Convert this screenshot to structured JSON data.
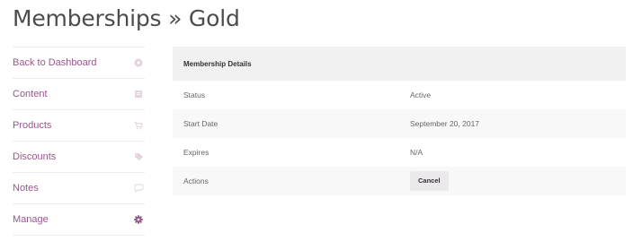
{
  "page": {
    "title": "Memberships » Gold"
  },
  "sidebar": {
    "items": [
      {
        "label": "Back to Dashboard",
        "icon": "dashboard-circle-icon",
        "active": false
      },
      {
        "label": "Content",
        "icon": "content-icon",
        "active": false
      },
      {
        "label": "Products",
        "icon": "cart-icon",
        "active": false
      },
      {
        "label": "Discounts",
        "icon": "tag-icon",
        "active": false
      },
      {
        "label": "Notes",
        "icon": "speech-bubble-icon",
        "active": false
      },
      {
        "label": "Manage",
        "icon": "gear-icon",
        "active": true
      }
    ]
  },
  "details": {
    "header": "Membership Details",
    "rows": [
      {
        "label": "Status",
        "value": "Active"
      },
      {
        "label": "Start Date",
        "value": "September 20, 2017"
      },
      {
        "label": "Expires",
        "value": "N/A"
      },
      {
        "label": "Actions",
        "button": "Cancel"
      }
    ]
  },
  "colors": {
    "accent": "#96588a",
    "icon_muted": "#e2d3de",
    "header_bg": "#f1f1f1",
    "row_alt_bg": "#f8f8f8"
  }
}
